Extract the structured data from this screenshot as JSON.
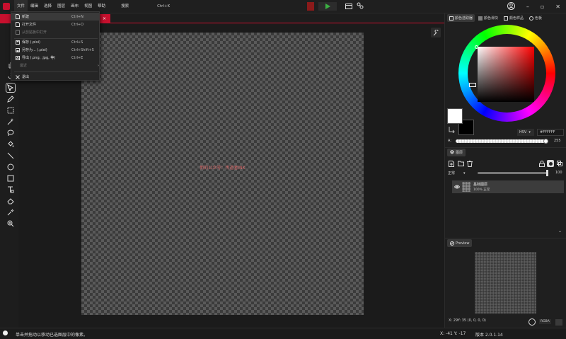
{
  "menubar": {
    "items": [
      "文件",
      "编辑",
      "选择",
      "图层",
      "画布",
      "视图",
      "帮助"
    ],
    "search_label": "搜索",
    "search_shortcut": "Ctrl+K"
  },
  "file_menu": {
    "items": [
      {
        "label": "新建",
        "shortcut": "Ctrl+N",
        "icon": "new-file-icon"
      },
      {
        "label": "打开文件",
        "shortcut": "Ctrl+O",
        "icon": "open-file-icon"
      },
      {
        "label": "从剪贴板中打开",
        "shortcut": "",
        "icon": "clipboard-icon",
        "disabled": true
      },
      {
        "label": "保存 (.pixi)",
        "shortcut": "Ctrl+S",
        "icon": "save-icon"
      },
      {
        "label": "另存为... (.pixi)",
        "shortcut": "Ctrl+Shift+S",
        "icon": "save-as-icon"
      },
      {
        "label": "导出 (.png, .jpg, 等)",
        "shortcut": "Ctrl+E",
        "icon": "export-icon"
      },
      {
        "label": "最近",
        "shortcut": "›",
        "icon": "",
        "disabled": true
      },
      {
        "label": "退出",
        "shortcut": "",
        "icon": "close-icon"
      }
    ]
  },
  "canvas": {
    "hint": "新的公众号：传道者INK"
  },
  "right_panel": {
    "tabs": [
      "颜色选取器",
      "颜色滑块",
      "颜色样品",
      "色板"
    ],
    "color_mode": "HSV",
    "hex_value": "#FFFFFF",
    "alpha_label": "A:",
    "alpha_value": "255",
    "alpha_fraction": 1.0
  },
  "layers": {
    "tab_label": "图层",
    "blend_mode": "正常",
    "opacity": "100",
    "opacity_fraction": 1.0,
    "layer_name": "基础图层",
    "layer_meta": "100%  正常"
  },
  "preview": {
    "tab_label": "Preview",
    "pixel_info": "X: 29Y: 35  (0, 0, 0, 0)",
    "mode": "RGBA"
  },
  "statusbar": {
    "message": "单击并拖动以移动已选图层中的像素。",
    "coords": "X: -41 Y: -17",
    "version": "版本 2.0.1.14"
  },
  "colors": {
    "accent": "#c8102e",
    "primary_color": "#ffffff",
    "secondary_color": "#000000"
  }
}
